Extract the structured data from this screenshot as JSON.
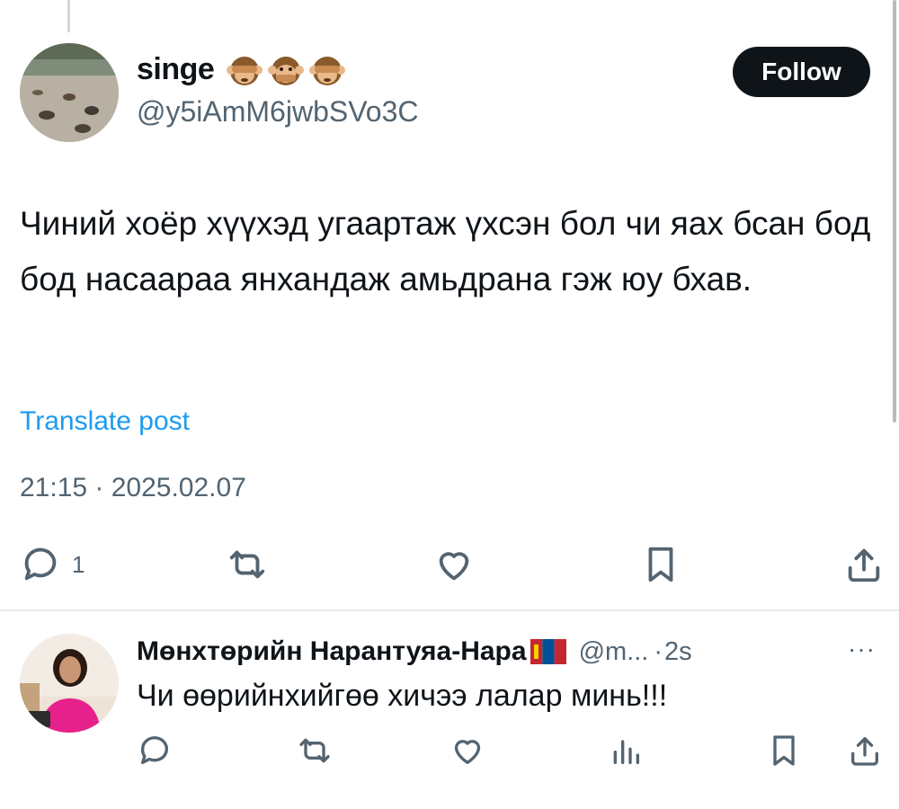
{
  "tweet": {
    "display_name": "singe",
    "name_emojis": [
      "see-no-evil-monkey",
      "speak-no-evil-monkey",
      "see-no-evil-monkey"
    ],
    "handle": "@y5iAmM6jwbSVo3C",
    "follow_label": "Follow",
    "text": "Чиний хоёр хүүхэд угаартаж үхсэн бол чи яах бсан бод бод насаараа янхандаж амьдрана гэж юу бхав.",
    "translate_label": "Translate post",
    "timestamp": "21:15 · 2025.02.07",
    "actions": {
      "reply_icon": "comment-icon",
      "reply_count": "1",
      "repost_icon": "repost-icon",
      "like_icon": "heart-icon",
      "bookmark_icon": "bookmark-icon",
      "share_icon": "share-icon"
    }
  },
  "reply": {
    "display_name": "Мөнхтөрийн Нарантуяа-Нара",
    "flag": "mongolia-flag",
    "handle": "@m...",
    "separator": "·",
    "time": "2s",
    "more_label": "···",
    "text": "Чи өөрийнхийгөө хичээ лалар минь!!!",
    "actions": [
      "comment-icon",
      "repost-icon",
      "heart-icon",
      "views-icon",
      "bookmark-icon",
      "share-icon"
    ]
  },
  "colors": {
    "text": "#0f1419",
    "secondary": "#536471",
    "link": "#1d9bf0",
    "follow_bg": "#0f1419",
    "reply_shirt": "#e6218b"
  }
}
